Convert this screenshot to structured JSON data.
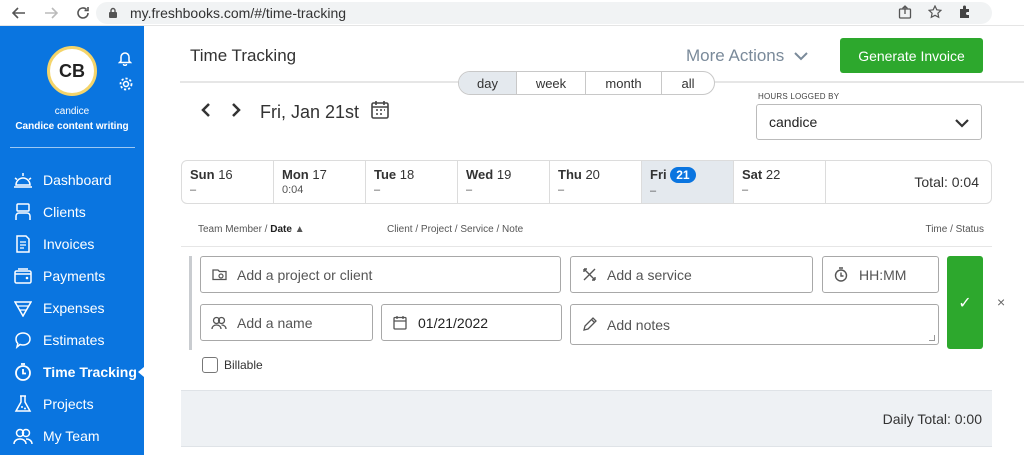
{
  "browser": {
    "url": "my.freshbooks.com/#/time-tracking"
  },
  "sidebar": {
    "avatar_initials": "CB",
    "user_name": "candice",
    "company": "Candice content writing",
    "items": [
      {
        "label": "Dashboard",
        "icon": "dashboard-icon"
      },
      {
        "label": "Clients",
        "icon": "clients-icon"
      },
      {
        "label": "Invoices",
        "icon": "invoices-icon"
      },
      {
        "label": "Payments",
        "icon": "payments-icon"
      },
      {
        "label": "Expenses",
        "icon": "expenses-icon"
      },
      {
        "label": "Estimates",
        "icon": "estimates-icon"
      },
      {
        "label": "Time Tracking",
        "icon": "time-tracking-icon",
        "active": true
      },
      {
        "label": "Projects",
        "icon": "projects-icon"
      },
      {
        "label": "My Team",
        "icon": "my-team-icon"
      }
    ]
  },
  "header": {
    "title": "Time Tracking",
    "more_actions": "More Actions",
    "generate_invoice": "Generate Invoice"
  },
  "period_tabs": [
    "day",
    "week",
    "month",
    "all"
  ],
  "active_period": "day",
  "date_nav": {
    "label": "Fri, Jan 21st"
  },
  "hours_logged_by": {
    "label": "HOURS LOGGED BY",
    "value": "candice"
  },
  "week": {
    "days": [
      {
        "name": "Sun",
        "num": "16",
        "hours": "–"
      },
      {
        "name": "Mon",
        "num": "17",
        "hours": "0:04"
      },
      {
        "name": "Tue",
        "num": "18",
        "hours": "–"
      },
      {
        "name": "Wed",
        "num": "19",
        "hours": "–"
      },
      {
        "name": "Thu",
        "num": "20",
        "hours": "–"
      },
      {
        "name": "Fri",
        "num": "21",
        "hours": "–",
        "active": true
      },
      {
        "name": "Sat",
        "num": "22",
        "hours": "–"
      }
    ],
    "total": "Total: 0:04"
  },
  "columns": {
    "member_prefix": "Team Member /",
    "member_sort": "Date",
    "sort_arrow": "▲",
    "client": "Client / Project / Service / Note",
    "time": "Time / Status"
  },
  "entry": {
    "project_placeholder": "Add a project or client",
    "service_placeholder": "Add a service",
    "time_placeholder": "HH:MM",
    "name_placeholder": "Add a name",
    "date_value": "01/21/2022",
    "notes_placeholder": "Add notes",
    "billable_label": "Billable",
    "save_icon": "✓",
    "close_icon": "×"
  },
  "daily_total": "Daily Total: 0:00",
  "colors": {
    "sidebar": "#0a75e0",
    "accent_green": "#2da82d"
  }
}
